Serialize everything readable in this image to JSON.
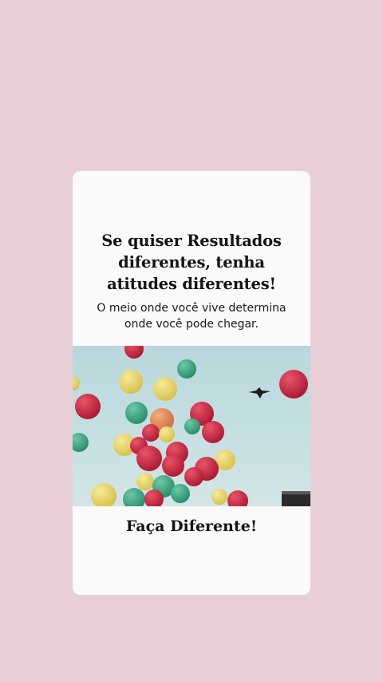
{
  "card": {
    "headline": "Se quiser Resultados\ndiferentes, tenha\natitudes diferentes!",
    "subline": "O meio onde você vive determina\nonde você pode chegar.",
    "cta": "Faça Diferente!"
  },
  "colors": {
    "background": "#e8cfd5",
    "card": "#fbfaf9",
    "sky": "#c4dfe2",
    "balloon_red": "#c8263f",
    "balloon_yellow": "#e9d66a",
    "balloon_green": "#3faa86",
    "balloon_orange": "#e38c5e"
  },
  "photo": {
    "subject": "balloons-and-bird"
  }
}
